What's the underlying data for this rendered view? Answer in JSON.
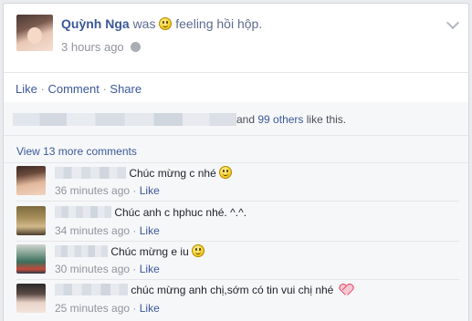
{
  "post": {
    "author_name": "Quỳnh Nga",
    "verb": "was",
    "feeling_text": "feeling hồi hộp.",
    "time": "3 hours ago"
  },
  "actions": {
    "like": "Like",
    "comment": "Comment",
    "share": "Share",
    "sep": "·"
  },
  "likes": {
    "and_text": "and",
    "others_link": "99 others",
    "suffix": "like this."
  },
  "view_more": "View 13 more comments",
  "comments": [
    {
      "text": "Chúc mừng c nhé",
      "emoji": "smiley",
      "time": "36 minutes ago",
      "like": "Like"
    },
    {
      "text": "Chúc anh c hphuc nhé. ^.^.",
      "time": "34 minutes ago",
      "like": "Like"
    },
    {
      "text": "Chúc mừng e iu",
      "emoji": "smiley",
      "time": "30 minutes ago",
      "like": "Like"
    },
    {
      "text": "chúc mừng anh chị,sớm có tin vui chị nhé",
      "emoji": "heart",
      "time": "25 minutes ago",
      "like": "Like"
    }
  ],
  "colors": {
    "link": "#3b5998",
    "muted": "#90949c",
    "feedback_bg": "#f6f7f9"
  }
}
